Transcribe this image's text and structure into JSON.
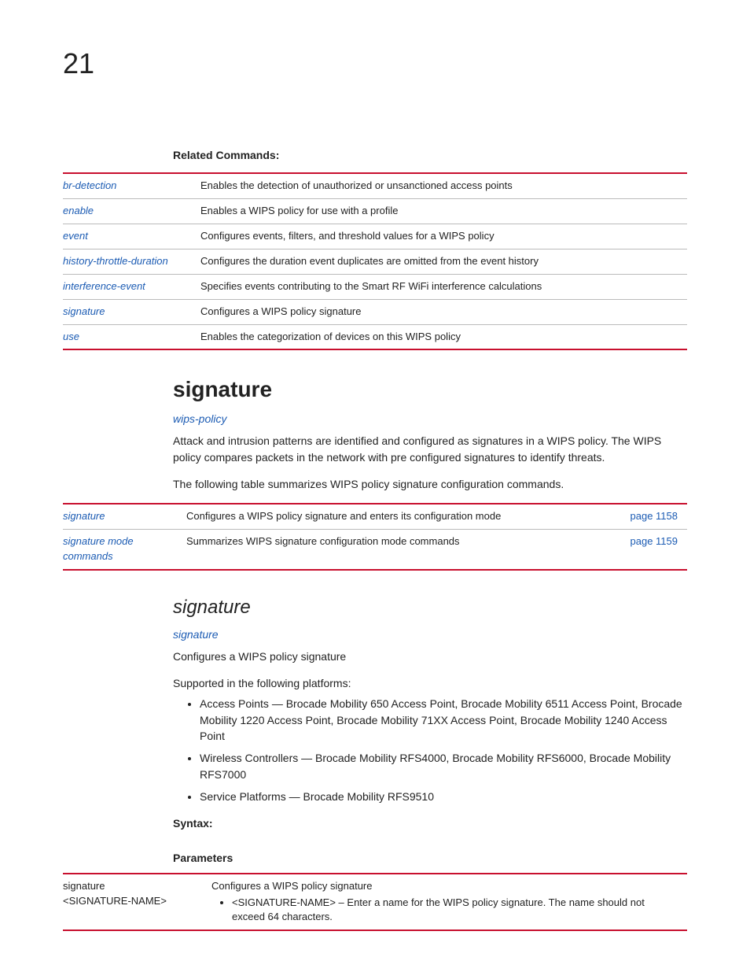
{
  "chapter": "21",
  "related_heading": "Related Commands:",
  "related_commands": [
    {
      "cmd": "br-detection",
      "desc": "Enables the detection of unauthorized or unsanctioned access points"
    },
    {
      "cmd": "enable",
      "desc": "Enables a WIPS policy for use with a profile"
    },
    {
      "cmd": "event",
      "desc": "Configures events, filters, and threshold values for a WIPS policy"
    },
    {
      "cmd": "history-throttle-duration",
      "desc": "Configures the duration event duplicates are omitted from the event history"
    },
    {
      "cmd": "interference-event",
      "desc": "Specifies events contributing to the Smart RF WiFi interference calculations"
    },
    {
      "cmd": "signature",
      "desc": "Configures a WIPS policy signature"
    },
    {
      "cmd": "use",
      "desc": "Enables the categorization of devices on this WIPS policy"
    }
  ],
  "sig_heading": "signature",
  "sig_parent_link": "wips-policy",
  "sig_intro": "Attack and intrusion patterns are identified and configured as signatures in a WIPS policy. The WIPS policy compares packets in the network with pre configured signatures to identify threats.",
  "sig_table_intro": "The following table summarizes WIPS policy signature configuration commands.",
  "sig_table": [
    {
      "cmd": "signature",
      "desc": "Configures a WIPS policy signature and enters its configuration mode",
      "page": "page 1158"
    },
    {
      "cmd": "signature mode commands",
      "desc": "Summarizes WIPS signature configuration mode commands",
      "page": "page 1159"
    }
  ],
  "subsig_heading": "signature",
  "subsig_parent": "signature",
  "subsig_desc": "Configures a WIPS policy signature",
  "supported_label": "Supported in the following platforms:",
  "platforms": [
    "Access Points — Brocade Mobility 650 Access Point, Brocade Mobility 6511 Access Point, Brocade Mobility 1220 Access Point, Brocade Mobility 71XX Access Point, Brocade Mobility 1240 Access Point",
    "Wireless Controllers — Brocade Mobility RFS4000, Brocade Mobility RFS6000, Brocade Mobility RFS7000",
    "Service Platforms — Brocade Mobility RFS9510"
  ],
  "syntax_label": "Syntax:",
  "parameters_label": "Parameters",
  "param_left_1": "signature",
  "param_left_2": "<SIGNATURE-NAME>",
  "param_desc": "Configures a WIPS policy signature",
  "param_bullet": "<SIGNATURE-NAME> – Enter a name for the WIPS policy signature. The name should not exceed 64 characters."
}
